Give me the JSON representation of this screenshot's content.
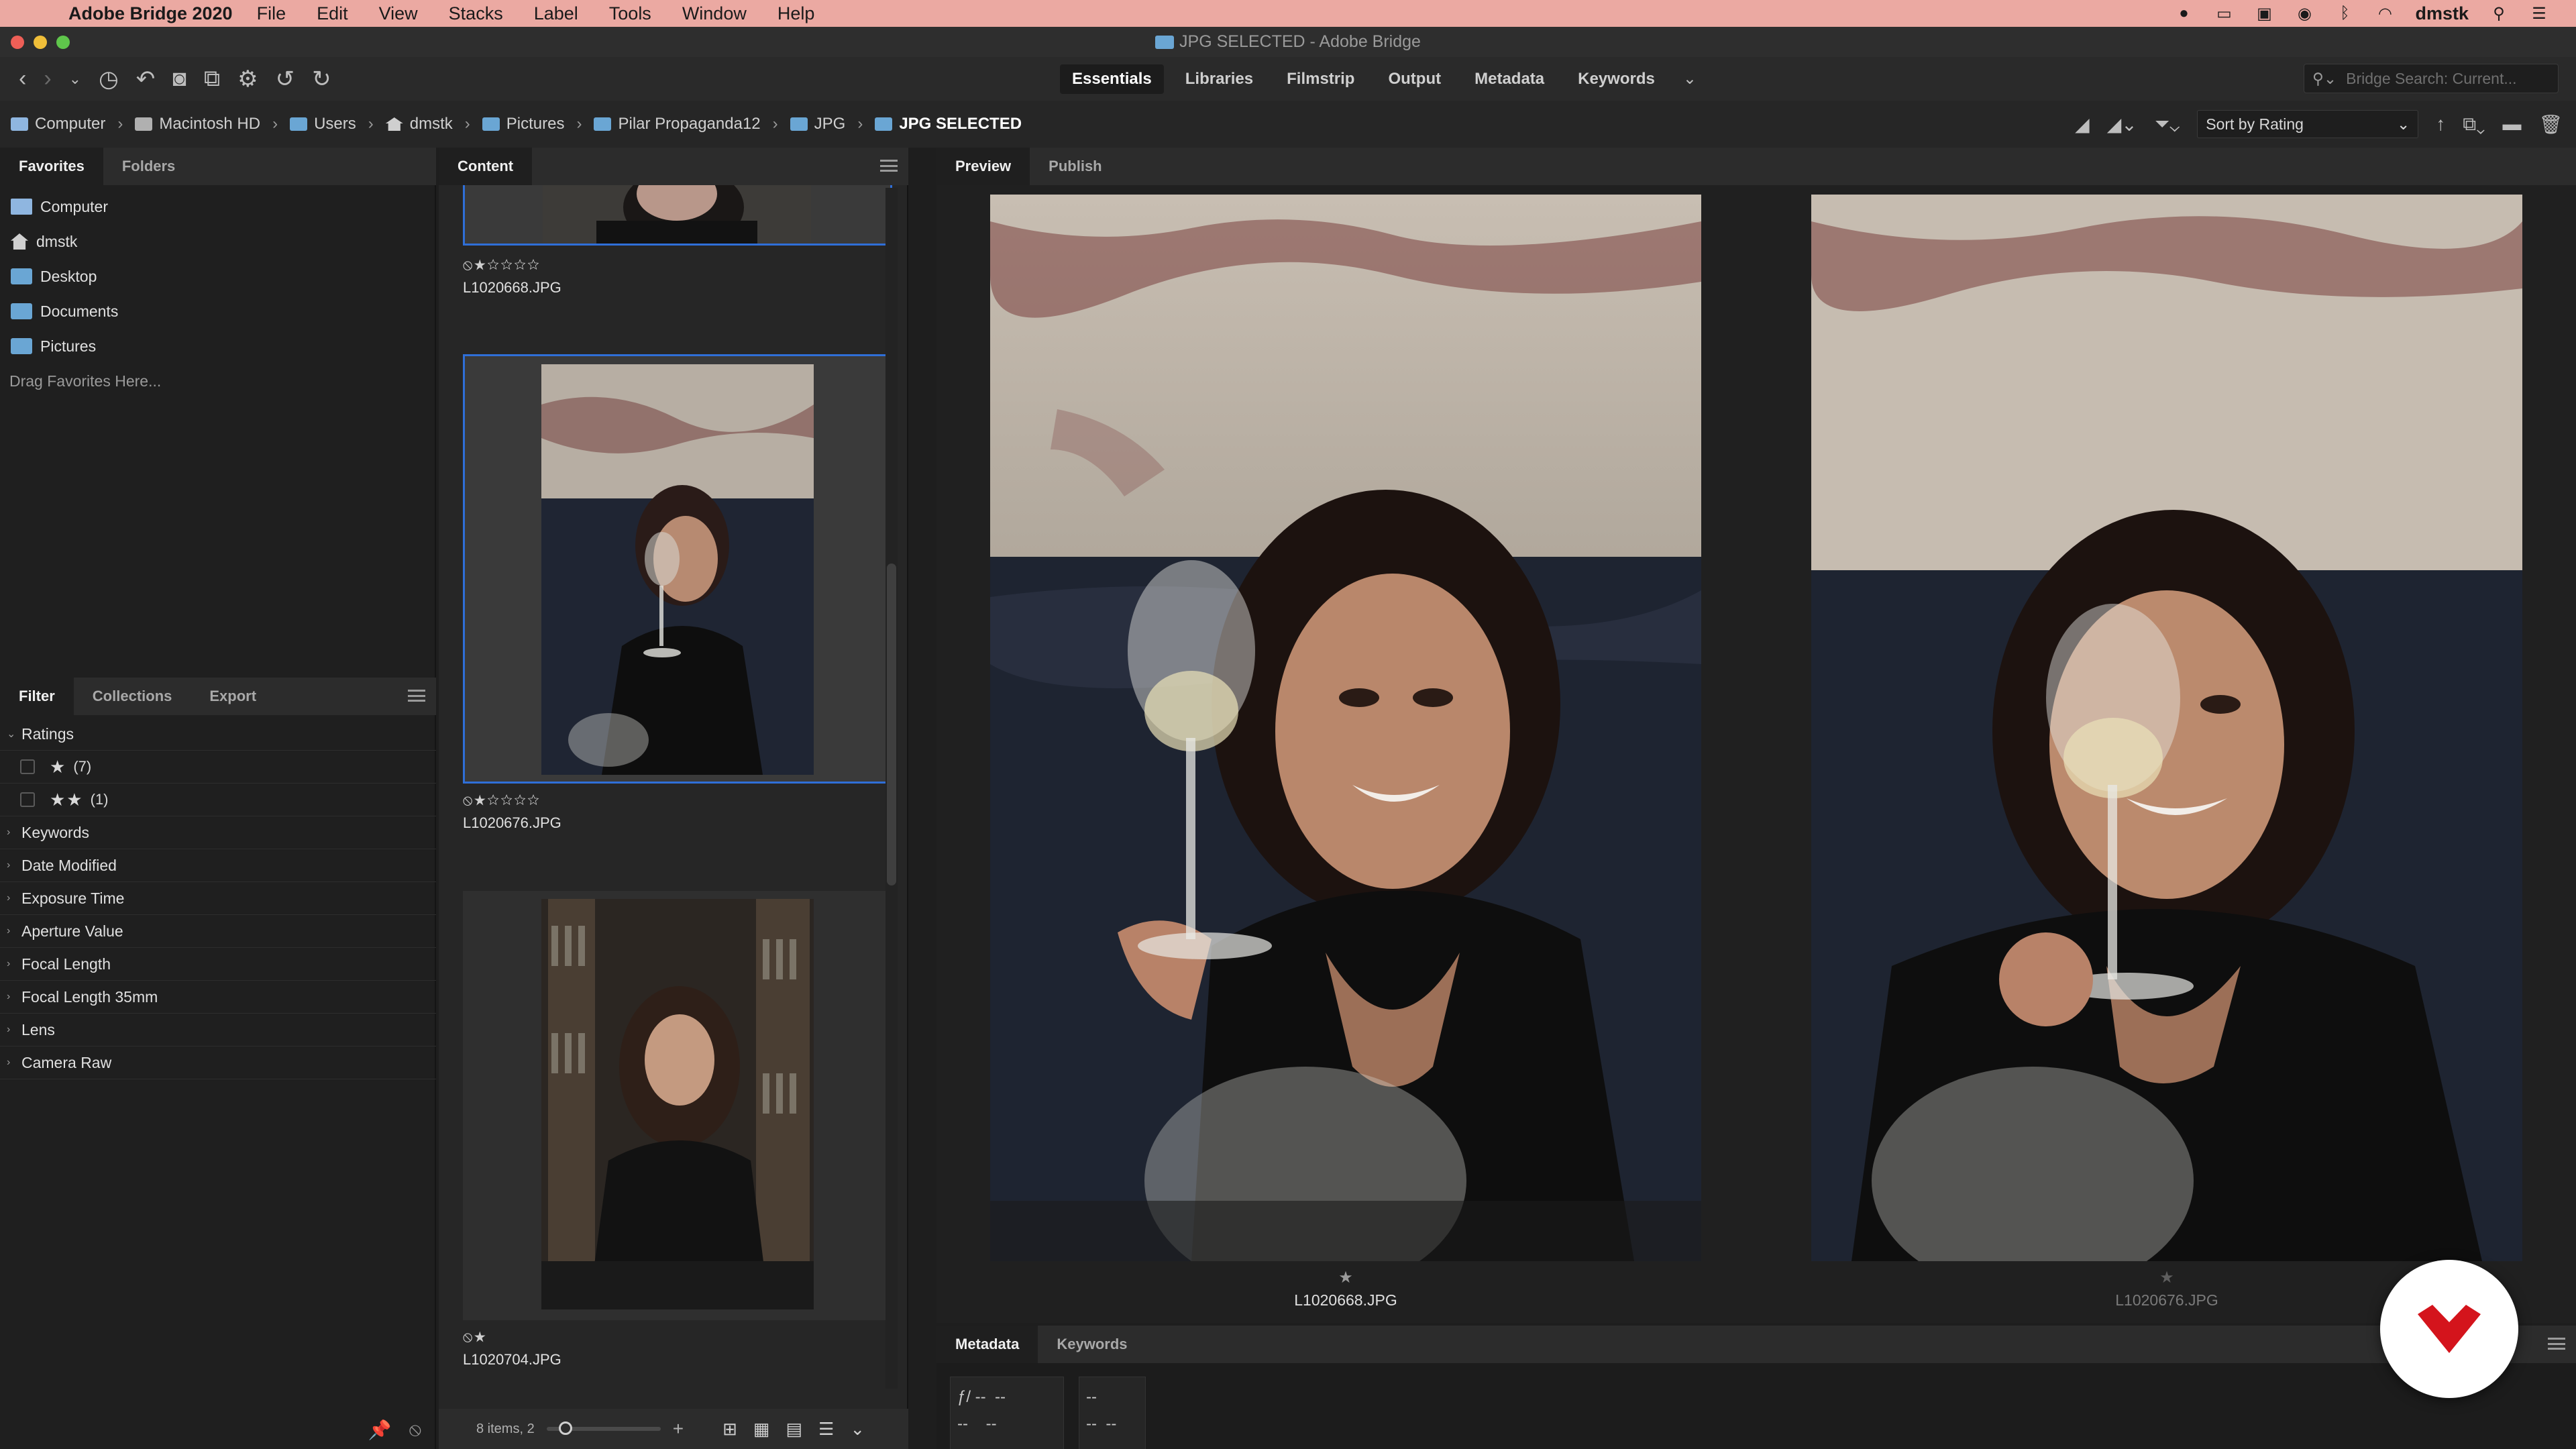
{
  "menubar": {
    "app_name": "Adobe Bridge 2020",
    "items": [
      "File",
      "Edit",
      "View",
      "Stacks",
      "Label",
      "Tools",
      "Window",
      "Help"
    ],
    "user": "dmstk"
  },
  "window": {
    "title": "JPG SELECTED - Adobe Bridge"
  },
  "toolbar": {
    "workspaces": [
      "Essentials",
      "Libraries",
      "Filmstrip",
      "Output",
      "Metadata",
      "Keywords"
    ],
    "active_workspace": "Essentials",
    "search_placeholder": "Bridge Search: Current..."
  },
  "pathbar": {
    "crumbs": [
      "Computer",
      "Macintosh HD",
      "Users",
      "dmstk",
      "Pictures",
      "Pilar Propaganda12",
      "JPG",
      "JPG SELECTED"
    ],
    "sort_label": "Sort by Rating"
  },
  "left_panel": {
    "tabs": [
      "Favorites",
      "Folders"
    ],
    "favorites": [
      "Computer",
      "dmstk",
      "Desktop",
      "Documents",
      "Pictures"
    ],
    "drag_hint": "Drag Favorites Here...",
    "filter_tabs": [
      "Filter",
      "Collections",
      "Export"
    ],
    "filter_ratings_label": "Ratings",
    "filter_ratings": [
      {
        "stars": "★",
        "count": "(7)"
      },
      {
        "stars": "★★",
        "count": "(1)"
      }
    ],
    "filter_sections": [
      "Keywords",
      "Date Modified",
      "Exposure Time",
      "Aperture Value",
      "Focal Length",
      "Focal Length 35mm",
      "Lens",
      "Camera Raw"
    ]
  },
  "content_panel": {
    "title": "Content",
    "items": [
      {
        "filename": "L1020668.JPG",
        "rating": "⦸★☆☆☆☆"
      },
      {
        "filename": "L1020676.JPG",
        "rating": "⦸★☆☆☆☆"
      },
      {
        "filename": "L1020704.JPG",
        "rating": "⦸★"
      }
    ],
    "status": "8 items, 2"
  },
  "preview_panel": {
    "tabs": [
      "Preview",
      "Publish"
    ],
    "images": [
      {
        "filename": "L1020668.JPG",
        "star": "★"
      },
      {
        "filename": "L1020676.JPG",
        "star": "★"
      }
    ]
  },
  "metadata_panel": {
    "tabs": [
      "Metadata",
      "Keywords"
    ],
    "aperture": "ƒ/ --",
    "placeholder": "--"
  },
  "colors": {
    "menubar": "#eba9a2",
    "selection": "#2f6fd8",
    "folder": "#6aa6d4",
    "logo_red": "#d4141c"
  }
}
